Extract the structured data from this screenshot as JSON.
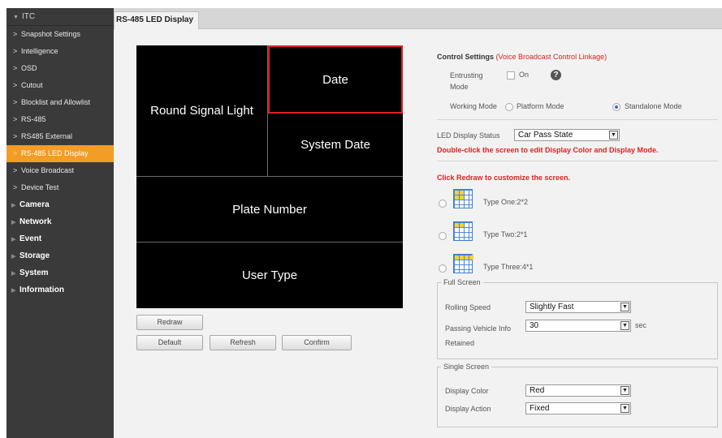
{
  "sidebar": {
    "header": "ITC",
    "items": [
      {
        "label": "Snapshot Settings"
      },
      {
        "label": "Intelligence"
      },
      {
        "label": "OSD"
      },
      {
        "label": "Cutout"
      },
      {
        "label": "Blocklist and Allowlist"
      },
      {
        "label": "RS-485"
      },
      {
        "label": "RS485 External"
      },
      {
        "label": "RS-485 LED Display",
        "active": true
      },
      {
        "label": "Voice Broadcast"
      },
      {
        "label": "Device Test"
      }
    ],
    "sections": [
      "Camera",
      "Network",
      "Event",
      "Storage",
      "System",
      "Information"
    ]
  },
  "tab": {
    "label": "RS-485 LED Display"
  },
  "screen": {
    "round_signal_light": "Round Signal Light",
    "date": "Date",
    "system_date": "System Date",
    "plate_number": "Plate Number",
    "user_type": "User Type"
  },
  "buttons": {
    "redraw": "Redraw",
    "default": "Default",
    "refresh": "Refresh",
    "confirm": "Confirm"
  },
  "control": {
    "title": "Control Settings",
    "title_note": "(Voice Broadcast Control Linkage)",
    "entrusting_mode_label": "Entrusting Mode",
    "on_label": "On",
    "working_mode_label": "Working Mode",
    "platform_mode": "Platform Mode",
    "standalone_mode": "Standalone Mode",
    "selected_mode": "Standalone Mode"
  },
  "led": {
    "status_label": "LED Display Status",
    "status_value": "Car Pass State",
    "hint": "Double-click the screen to edit Display Color and Display Mode.",
    "redraw_hint": "Click Redraw to customize the screen.",
    "types": [
      "Type One:2*2",
      "Type Two:2*1",
      "Type Three:4*1"
    ]
  },
  "full_screen": {
    "legend": "Full Screen",
    "rolling_speed_label": "Rolling Speed",
    "rolling_speed_value": "Slightly Fast",
    "passing_label": "Passing Vehicle Info Retained",
    "passing_value": "30",
    "passing_unit": "sec"
  },
  "single_screen": {
    "legend": "Single Screen",
    "display_color_label": "Display Color",
    "display_color_value": "Red",
    "display_action_label": "Display Action",
    "display_action_value": "Fixed"
  },
  "colors": {
    "accent": "#f39c26",
    "highlight_red": "#e02020",
    "sidebar_bg": "#3a3a3a"
  }
}
